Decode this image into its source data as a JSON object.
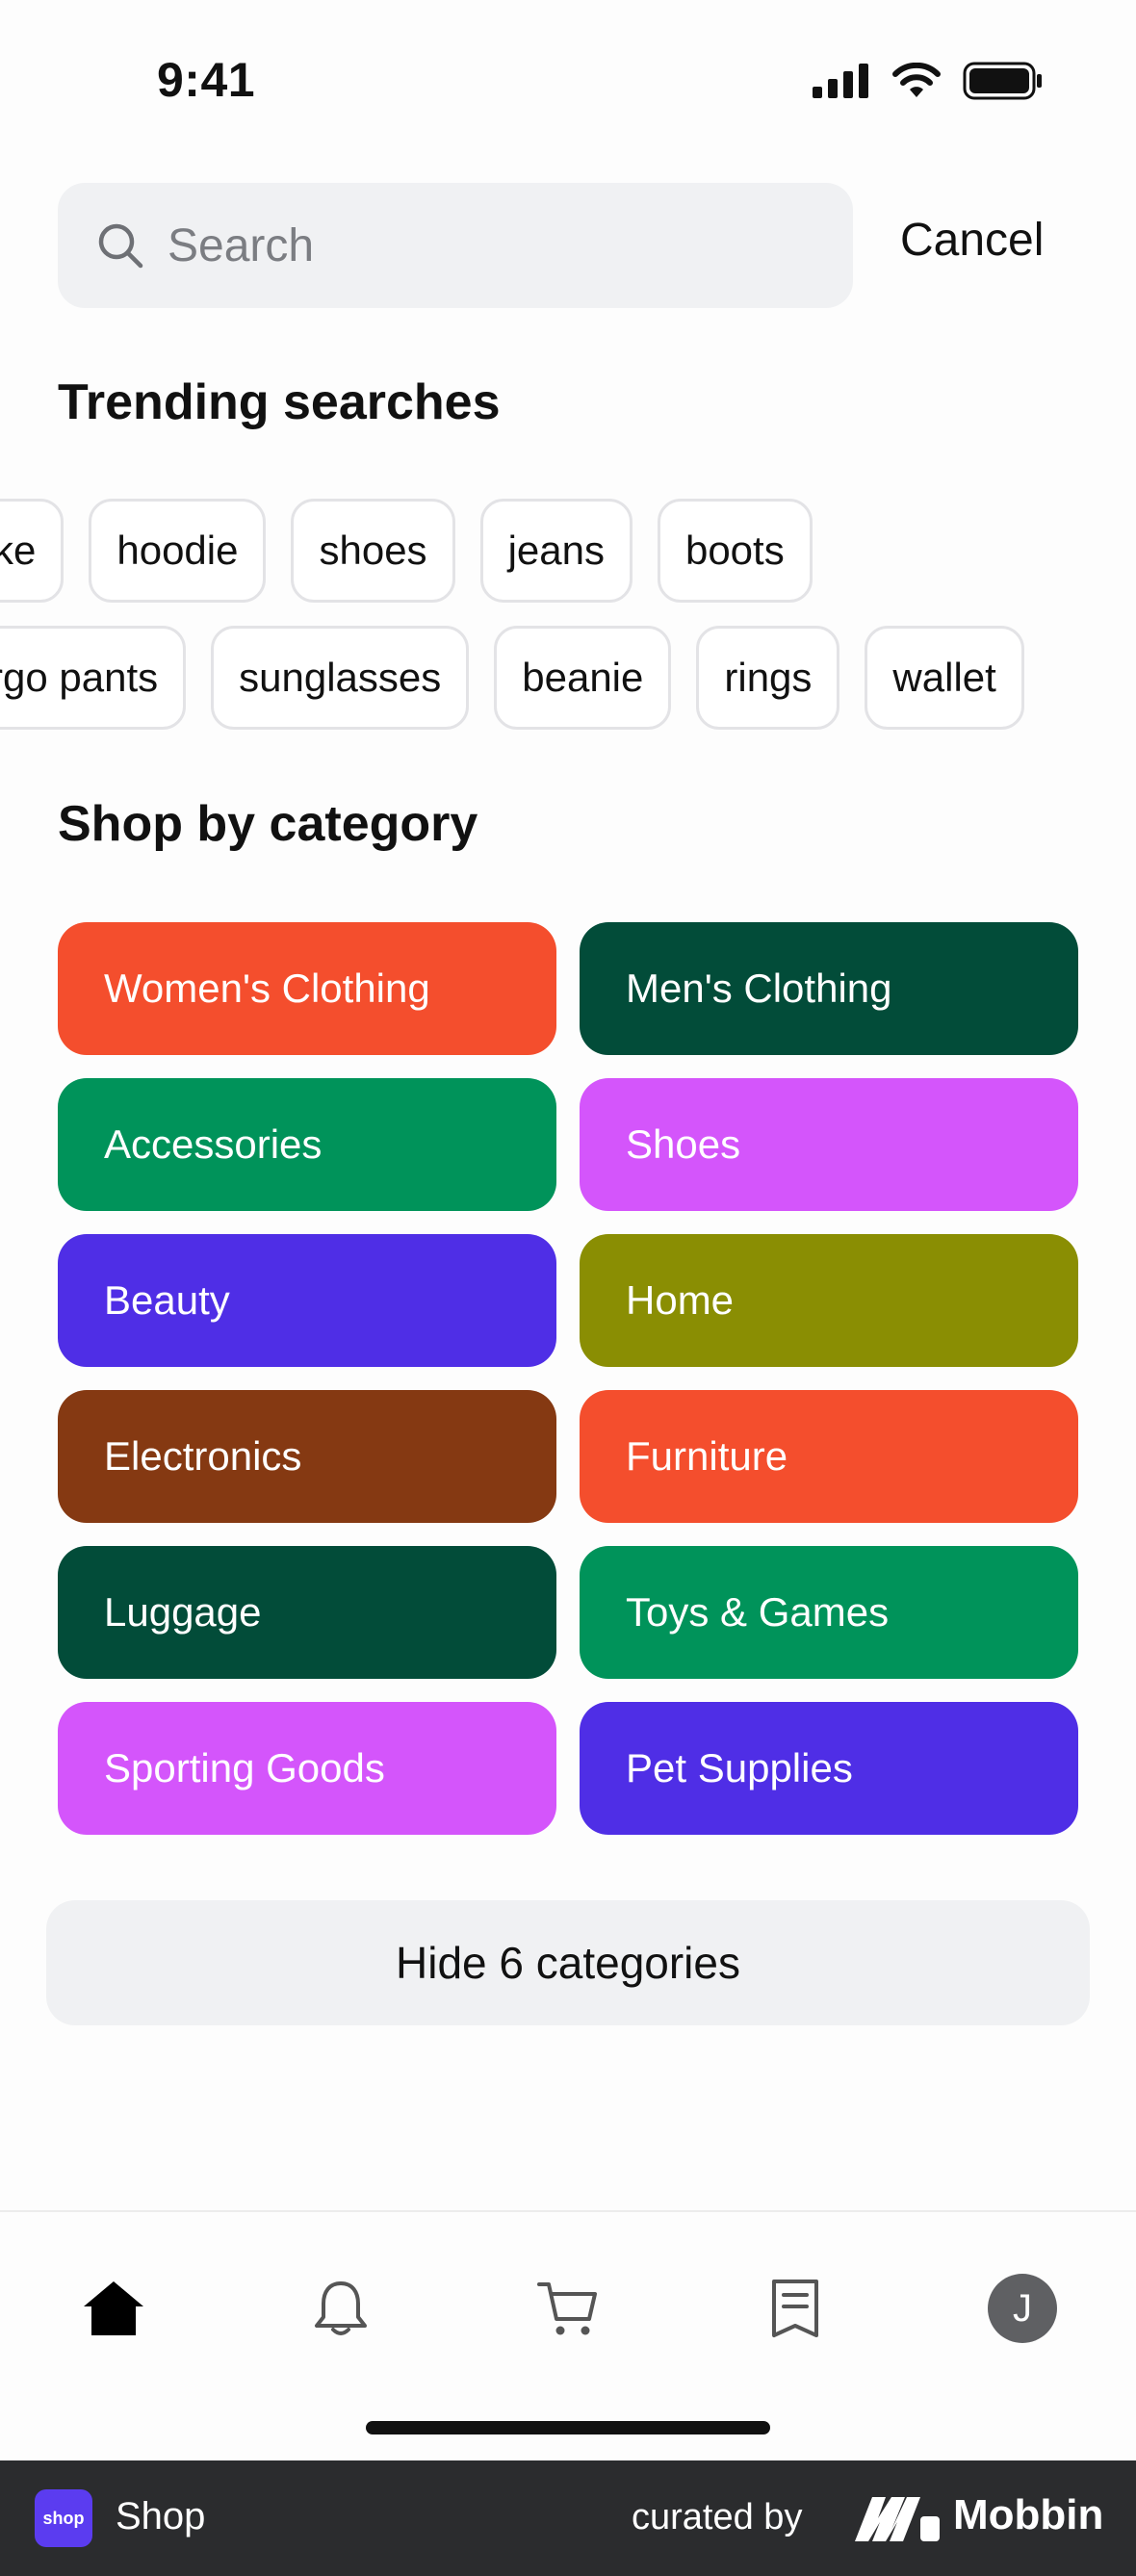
{
  "status_bar": {
    "time": "9:41"
  },
  "search": {
    "placeholder": "Search",
    "cancel_label": "Cancel"
  },
  "trending": {
    "title": "Trending searches",
    "row1": [
      "ke",
      "hoodie",
      "shoes",
      "jeans",
      "boots"
    ],
    "row2": [
      "rgo pants",
      "sunglasses",
      "beanie",
      "rings",
      "wallet"
    ]
  },
  "categories": {
    "title": "Shop by category",
    "items": [
      {
        "label": "Women's Clothing",
        "color": "#f44e2d"
      },
      {
        "label": "Men's Clothing",
        "color": "#024c39"
      },
      {
        "label": "Accessories",
        "color": "#00935a"
      },
      {
        "label": "Shoes",
        "color": "#d455fb"
      },
      {
        "label": "Beauty",
        "color": "#4f2ee6"
      },
      {
        "label": "Home",
        "color": "#8a8e03"
      },
      {
        "label": "Electronics",
        "color": "#853912"
      },
      {
        "label": "Furniture",
        "color": "#f44e2d"
      },
      {
        "label": "Luggage",
        "color": "#024c39"
      },
      {
        "label": "Toys & Games",
        "color": "#00935a"
      },
      {
        "label": "Sporting Goods",
        "color": "#d455fb"
      },
      {
        "label": "Pet Supplies",
        "color": "#4f2ee6"
      }
    ],
    "hide_label": "Hide 6 categories"
  },
  "tab_bar": {
    "tabs": [
      {
        "icon": "home-icon"
      },
      {
        "icon": "bell-icon"
      },
      {
        "icon": "cart-icon"
      },
      {
        "icon": "receipt-icon"
      },
      {
        "icon": "avatar",
        "initial": "J"
      }
    ]
  },
  "footer": {
    "app_badge": "shop",
    "app_name": "Shop",
    "curated_by": "curated by",
    "brand": "Mobbin"
  }
}
